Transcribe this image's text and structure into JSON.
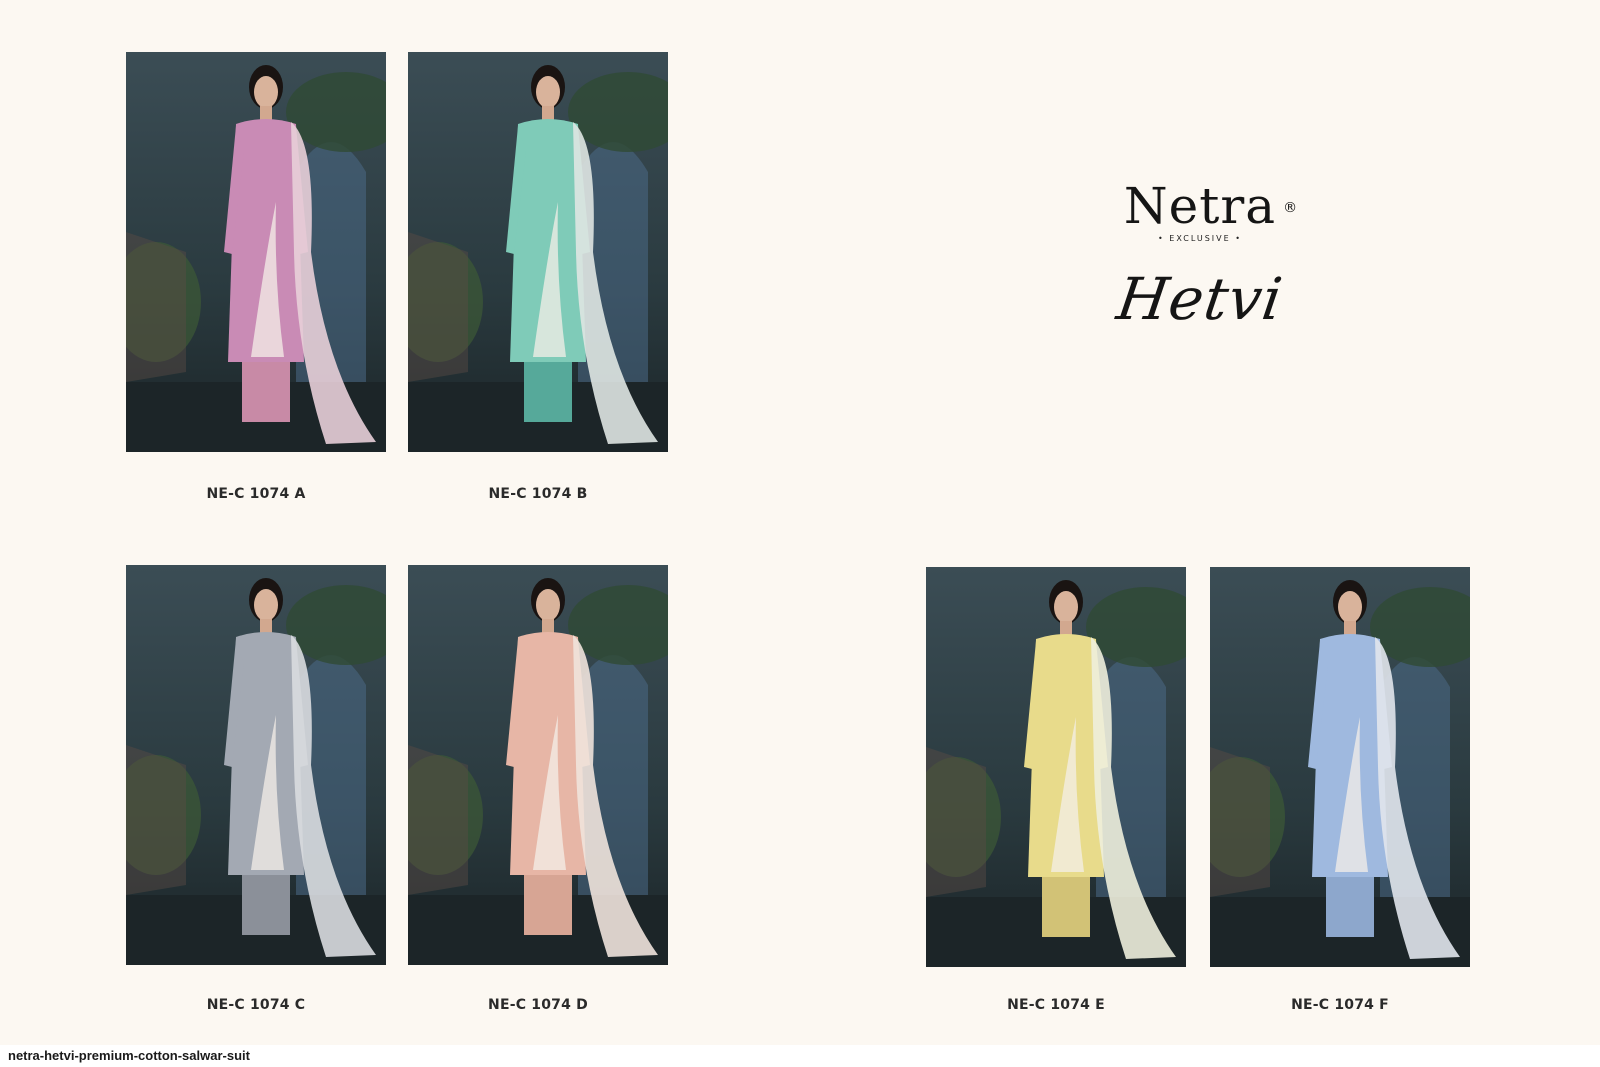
{
  "brand": {
    "name": "Netra",
    "registered_mark": "®",
    "tagline": "• EXCLUSIVE •",
    "collection": "Hetvi"
  },
  "products": [
    {
      "code": "NE-C 1074 A",
      "kurta_color": "#c98bb5",
      "dupatta_color": "#e8cfd8",
      "bottom_color": "#c88aa6"
    },
    {
      "code": "NE-C 1074 B",
      "kurta_color": "#7fcbb8",
      "dupatta_color": "#dfe6e2",
      "bottom_color": "#56a99a"
    },
    {
      "code": "NE-C 1074 C",
      "kurta_color": "#a3a9b3",
      "dupatta_color": "#d9dcdf",
      "bottom_color": "#8b9099"
    },
    {
      "code": "NE-C 1074 D",
      "kurta_color": "#e7b6a6",
      "dupatta_color": "#efe3dc",
      "bottom_color": "#d7a594"
    },
    {
      "code": "NE-C 1074 E",
      "kurta_color": "#e8db8b",
      "dupatta_color": "#eeeedb",
      "bottom_color": "#d2c276"
    },
    {
      "code": "NE-C 1074 F",
      "kurta_color": "#9fb9df",
      "dupatta_color": "#e1e6ec",
      "bottom_color": "#8da7cc"
    }
  ],
  "caption": "netra-hetvi-premium-cotton-salwar-suit"
}
